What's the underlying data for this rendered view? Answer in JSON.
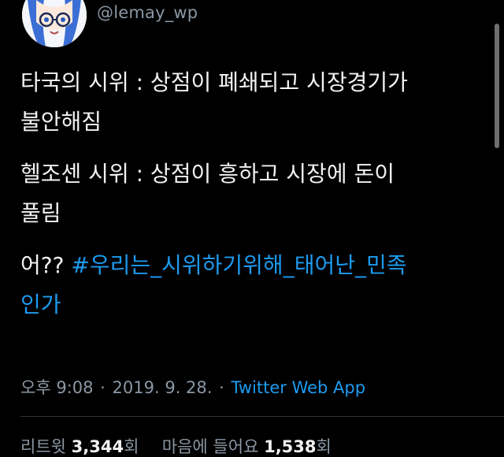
{
  "user": {
    "handle": "@lemay_wp",
    "avatar_icon": "anime-girl-avatar-icon"
  },
  "tweet": {
    "line1": "타국의 시위 : 상점이 폐쇄되고 시장경기가\n불안해짐",
    "line2": "헬조센 시위 : 상점이 흥하고 시장에 돈이\n풀림",
    "line3_prefix": "어?? ",
    "hashtag": "#우리는_시위하기위해_태어난_민족\n인가"
  },
  "meta": {
    "time": "오후 9:08",
    "separator": "·",
    "date": "2019. 9. 28.",
    "source": "Twitter Web App"
  },
  "stats": {
    "retweets_label": "리트윗",
    "retweets_count": "3,344",
    "retweets_suffix": "회",
    "likes_label": "마음에 들어요",
    "likes_count": "1,538",
    "likes_suffix": "회"
  },
  "colors": {
    "background": "#000000",
    "link": "#1d9bf0",
    "muted": "#8b98a5",
    "text": "#f2f2f2"
  }
}
